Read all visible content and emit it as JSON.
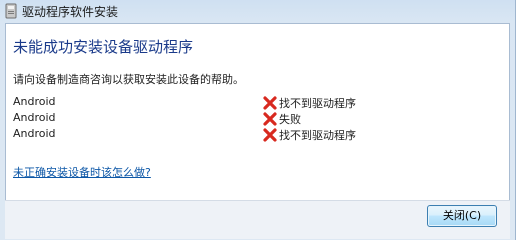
{
  "window": {
    "title": "驱动程序软件安装"
  },
  "main": {
    "heading": "未能成功安装设备驱动程序",
    "description": "请向设备制造商咨询以获取安装此设备的帮助。",
    "devices": [
      {
        "name": "Android",
        "status": "找不到驱动程序",
        "status_icon": "error-x-icon"
      },
      {
        "name": "Android",
        "status": "失败",
        "status_icon": "error-x-icon"
      },
      {
        "name": "Android",
        "status": "找不到驱动程序",
        "status_icon": "error-x-icon"
      }
    ],
    "help_link": "未正确安装设备时该怎么做?"
  },
  "footer": {
    "close_label": "关闭(C)"
  },
  "colors": {
    "heading": "#1a3a8a",
    "link": "#0d57a7",
    "error": "#d8291f"
  }
}
